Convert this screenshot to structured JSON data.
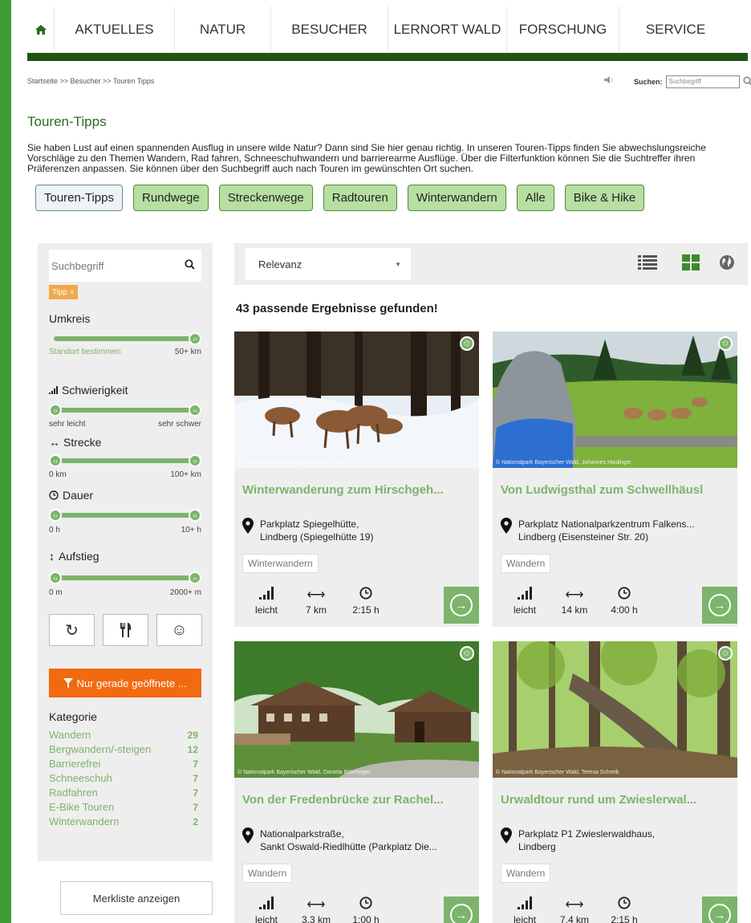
{
  "nav": {
    "items": [
      "AKTUELLES",
      "NATUR",
      "BESUCHER",
      "LERNORT WALD",
      "FORSCHUNG",
      "SERVICE"
    ]
  },
  "breadcrumb": "Startseite >> Besucher >> Touren Tipps",
  "search_top": {
    "label": "Suchen:",
    "placeholder": "Suchbegriff"
  },
  "page": {
    "title": "Touren-Tipps",
    "intro": "Sie haben Lust auf einen spannenden Ausflug in unsere wilde Natur? Dann sind Sie hier genau richtig. In unseren Touren-Tipps finden Sie abwechslungsreiche Vorschläge zu den Themen Wandern, Rad fahren, Schneeschuhwandern und barrierearme Ausflüge. Über die Filterfunktion können Sie die Suchtreffer ihren Präferenzen anpassen. Sie können über den Suchbegriff auch nach Touren im gewünschten Ort suchen."
  },
  "tabs": [
    "Touren-Tipps",
    "Rundwege",
    "Streckenwege",
    "Radtouren",
    "Winterwandern",
    "Alle",
    "Bike & Hike"
  ],
  "sidebar": {
    "search_placeholder": "Suchbegriff",
    "tag": "Tipp ×",
    "umkreis": {
      "label": "Umkreis",
      "left": "Standort bestimmen",
      "right": "50+ km"
    },
    "schwierigkeit": {
      "label": "Schwierigkeit",
      "left": "sehr leicht",
      "right": "sehr schwer"
    },
    "strecke": {
      "label": "Strecke",
      "left": "0 km",
      "right": "100+ km"
    },
    "dauer": {
      "label": "Dauer",
      "left": "0 h",
      "right": "10+ h"
    },
    "aufstieg": {
      "label": "Aufstieg",
      "left": "0 m",
      "right": "2000+ m"
    },
    "open_button": "Nur gerade geöffnete ...",
    "category_title": "Kategorie",
    "categories": [
      {
        "name": "Wandern",
        "count": "29"
      },
      {
        "name": "Bergwandern/-steigen",
        "count": "12"
      },
      {
        "name": "Barrierefrei",
        "count": "7"
      },
      {
        "name": "Schneeschuh",
        "count": "7"
      },
      {
        "name": "Radfahren",
        "count": "7"
      },
      {
        "name": "E-Bike Touren",
        "count": "7"
      },
      {
        "name": "Winterwandern",
        "count": "2"
      }
    ],
    "merkliste": "Merkliste anzeigen"
  },
  "sort": {
    "selected": "Relevanz"
  },
  "result_count": "43 passende Ergebnisse gefunden!",
  "cards": [
    {
      "title": "Winterwanderung zum Hirschgeh...",
      "loc1": "Parkplatz Spiegelhütte,",
      "loc2": "Lindberg (Spiegelhütte 19)",
      "tag": "Winterwandern",
      "difficulty": "leicht",
      "distance": "7 km",
      "duration": "2:15 h",
      "credit": "© Nationalparkverwaltung Bayerischer Wald"
    },
    {
      "title": "Von Ludwigsthal zum Schwellhäusl",
      "loc1": "Parkplatz Nationalparkzentrum Falkens...",
      "loc2": "Lindberg (Eisensteiner Str. 20)",
      "tag": "Wandern",
      "difficulty": "leicht",
      "distance": "14 km",
      "duration": "4:00 h",
      "credit": "© Nationalpark Bayerischer Wald, Johannes Haslinger"
    },
    {
      "title": "Von der Fredenbrücke zur Rachel...",
      "loc1": "Nationalparkstraße,",
      "loc2": "Sankt Oswald-Riedlhütte (Parkplatz Die...",
      "tag": "Wandern",
      "difficulty": "leicht",
      "distance": "3,3 km",
      "duration": "1:00 h",
      "credit": "© Nationalpark Bayerischer Wald, Daniela Blöchinger"
    },
    {
      "title": "Urwaldtour rund um Zwieslerwal...",
      "loc1": "Parkplatz P1 Zwieslerwaldhaus,",
      "loc2": "Lindberg",
      "tag": "Wandern",
      "difficulty": "leicht",
      "distance": "7,4 km",
      "duration": "2:15 h",
      "credit": "© Nationalpark Bayerischer Wald, Teresa Schreib"
    }
  ]
}
